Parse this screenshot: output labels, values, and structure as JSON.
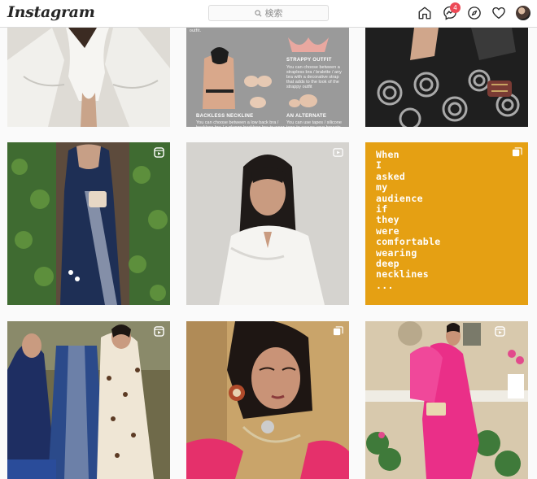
{
  "app": {
    "brand": "Instagram"
  },
  "search": {
    "placeholder": "検索"
  },
  "nav": {
    "dm_badge": "4"
  },
  "posts": [
    {
      "id": "post-1",
      "alt": "woman in white shirt"
    },
    {
      "id": "post-2",
      "alt": "infographic",
      "labels": {
        "strappy_title": "STRAPPY OUTFIT",
        "strappy_text": "You can choose between a strapless bra / bralette / any bra with a decorative strap that adds to the look of the strappy outfit",
        "backless_title": "BACKLESS NECKLINE",
        "backless_text": "You can choose between a low back bra / backless bra / a plunge backless bra to wear",
        "alternate_title": "AN ALTERNATE",
        "alternate_text": "You can use tapes / silicone tape to secure your breasts under",
        "top_text": "outfit."
      }
    },
    {
      "id": "post-3",
      "alt": "black saree"
    },
    {
      "id": "post-4",
      "alt": "blue saree"
    },
    {
      "id": "post-5",
      "alt": "woman white shirt portrait"
    },
    {
      "id": "post-6",
      "quote_lines": [
        "When",
        "I",
        "asked",
        "my",
        "audience",
        "if",
        "they",
        "were",
        "comfortable",
        "wearing",
        "deep",
        "necklines",
        "..."
      ]
    },
    {
      "id": "post-7",
      "alt": "two women ethnic wear"
    },
    {
      "id": "post-8",
      "alt": "woman with jewelry"
    },
    {
      "id": "post-9",
      "alt": "pink saree"
    }
  ],
  "colors": {
    "accent": "#ed4956",
    "quote_bg": "#e5a013"
  }
}
